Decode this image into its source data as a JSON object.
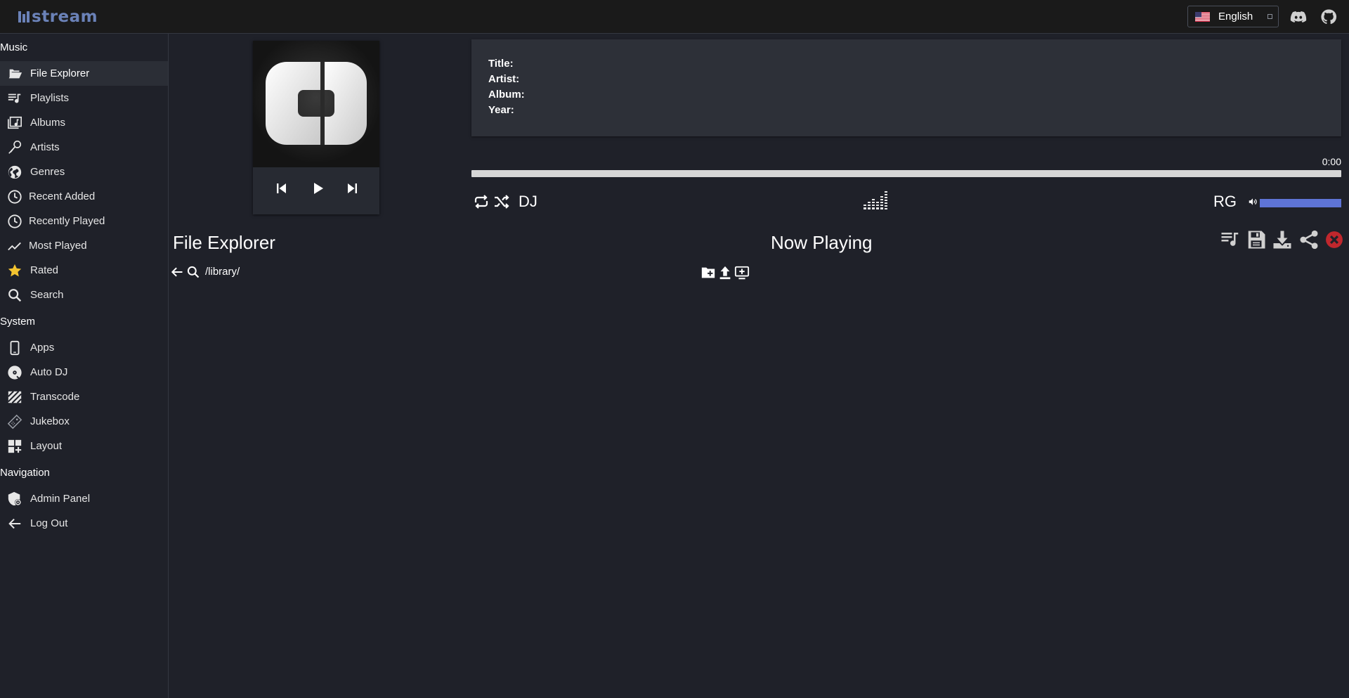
{
  "header": {
    "logo_text": "stream",
    "language": "English",
    "icons": [
      "discord-icon",
      "github-icon"
    ]
  },
  "sidebar": {
    "sections": [
      {
        "title": "Music",
        "items": [
          {
            "label": "File Explorer",
            "icon": "folder-open-icon",
            "active": true
          },
          {
            "label": "Playlists",
            "icon": "playlist-icon"
          },
          {
            "label": "Albums",
            "icon": "album-icon"
          },
          {
            "label": "Artists",
            "icon": "microphone-icon"
          },
          {
            "label": "Genres",
            "icon": "globe-icon"
          },
          {
            "label": "Recent Added",
            "icon": "clock-icon"
          },
          {
            "label": "Recently Played",
            "icon": "clock-icon"
          },
          {
            "label": "Most Played",
            "icon": "trend-up-icon"
          },
          {
            "label": "Rated",
            "icon": "star-icon"
          },
          {
            "label": "Search",
            "icon": "search-icon"
          }
        ]
      },
      {
        "title": "System",
        "items": [
          {
            "label": "Apps",
            "icon": "phone-icon"
          },
          {
            "label": "Auto DJ",
            "icon": "disc-icon"
          },
          {
            "label": "Transcode",
            "icon": "hatch-icon"
          },
          {
            "label": "Jukebox",
            "icon": "remote-icon"
          },
          {
            "label": "Layout",
            "icon": "layout-add-icon"
          }
        ]
      },
      {
        "title": "Navigation",
        "items": [
          {
            "label": "Admin Panel",
            "icon": "shield-icon"
          },
          {
            "label": "Log Out",
            "icon": "arrow-left-icon"
          }
        ]
      }
    ]
  },
  "player": {
    "meta": {
      "title_label": "Title:",
      "artist_label": "Artist:",
      "album_label": "Album:",
      "year_label": "Year:"
    },
    "time": "0:00",
    "progress": 1.0,
    "dj_label": "DJ",
    "rg_label": "RG",
    "volume": 1.0,
    "accent": "#5e74d6"
  },
  "file_explorer": {
    "title": "File Explorer",
    "path": "/library/"
  },
  "now_playing": {
    "title": "Now Playing",
    "clear_color": "#c0272d"
  }
}
